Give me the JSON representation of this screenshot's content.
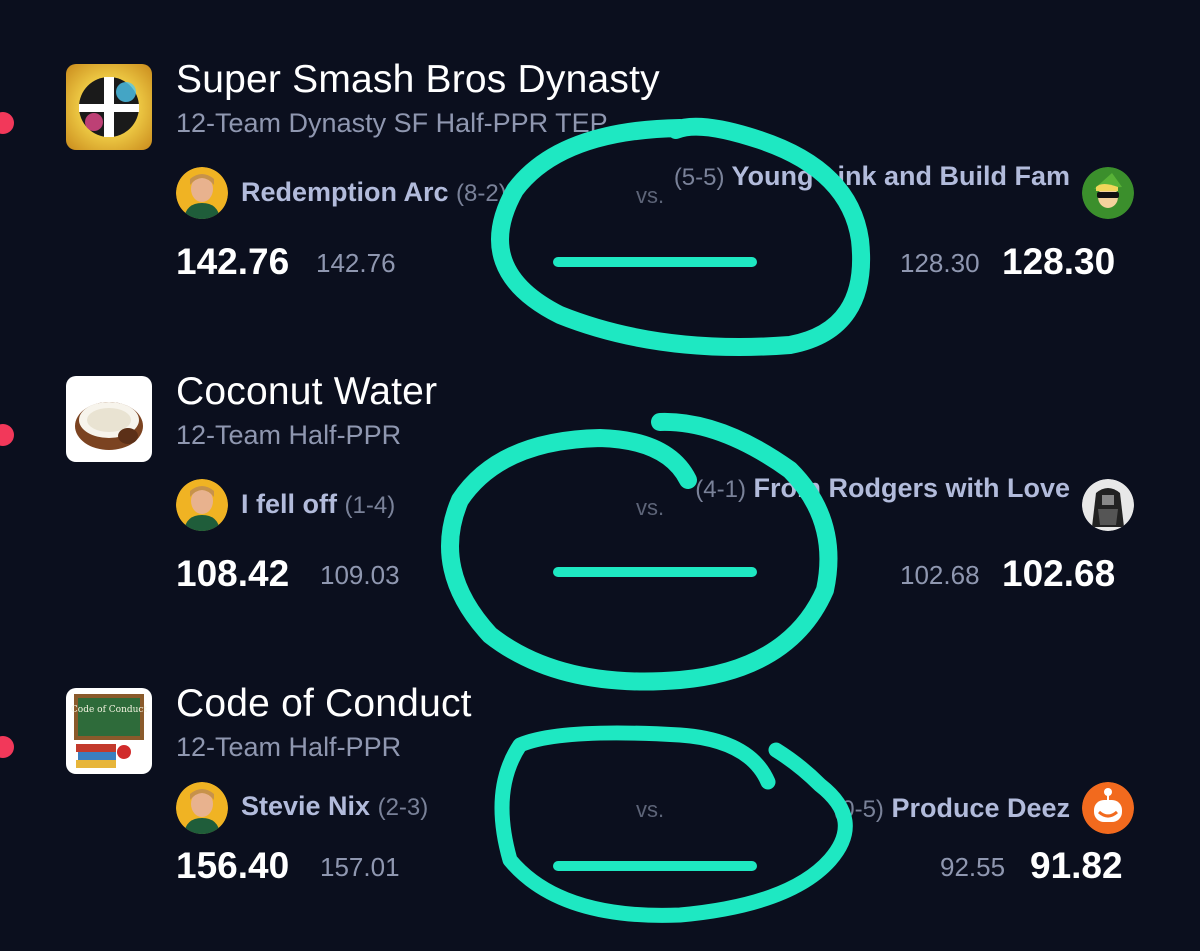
{
  "colors": {
    "background": "#0b0f1e",
    "dot": "#f2385a",
    "team_name": "#b2bbdb",
    "muted": "#8f97b0",
    "annotation": "#1ee8c2"
  },
  "leagues": [
    {
      "icon": "smash-bros-logo-icon",
      "title": "Super Smash Bros Dynasty",
      "subtitle": "12-Team Dynasty SF Half-PPR TEP",
      "left": {
        "avatar": "player-avatar-icon",
        "name": "Redemption Arc",
        "record": "(8-2)",
        "score": "142.76",
        "projected": "142.76"
      },
      "vs": "vs.",
      "right": {
        "avatar": "link-avatar-icon",
        "name": "Young Link and Build Fam",
        "record": "(5-5)",
        "score": "128.30",
        "projected": "128.30"
      }
    },
    {
      "icon": "coconut-icon",
      "title": "Coconut Water",
      "subtitle": "12-Team Half-PPR",
      "left": {
        "avatar": "player-avatar-icon",
        "name": "I fell off",
        "record": "(1-4)",
        "score": "108.42",
        "projected": "109.03"
      },
      "vs": "vs.",
      "right": {
        "avatar": "bw-character-avatar-icon",
        "name": "From Rodgers with Love",
        "record": "(4-1)",
        "score": "102.68",
        "projected": "102.68"
      }
    },
    {
      "icon": "code-of-conduct-chalkboard-icon",
      "icon_text": "Code of Conduct",
      "title": "Code of Conduct",
      "subtitle": "12-Team Half-PPR",
      "left": {
        "avatar": "player-avatar-icon",
        "name": "Stevie Nix",
        "record": "(2-3)",
        "score": "156.40",
        "projected": "157.01"
      },
      "vs": "vs.",
      "right": {
        "avatar": "orange-robot-avatar-icon",
        "name": "Produce Deez",
        "record": "(0-5)",
        "score": "91.82",
        "projected": "92.55"
      }
    }
  ]
}
